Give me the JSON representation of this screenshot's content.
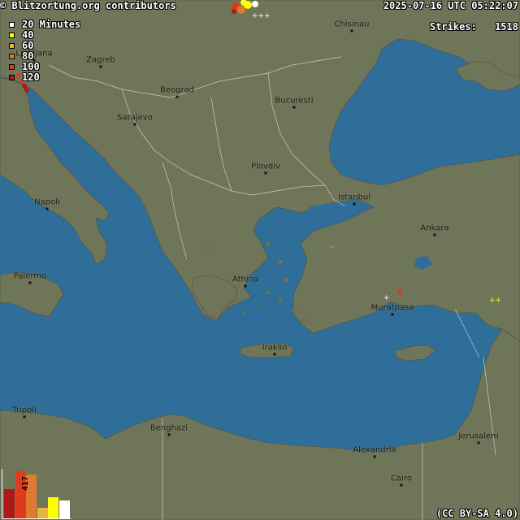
{
  "header": {
    "copyright": "© Blitzortung.org contributors",
    "timestamp": "2025-07-16 UTC 05:22:07",
    "strikes_label": "Strikes:",
    "strikes_count": "1518"
  },
  "legend": {
    "items": [
      {
        "label": "20 Minutes",
        "color": "#ffffff"
      },
      {
        "label": "40",
        "color": "#ffff00"
      },
      {
        "label": "60",
        "color": "#e8b23c"
      },
      {
        "label": "80",
        "color": "#e07a30"
      },
      {
        "label": "100",
        "color": "#e03a1e"
      },
      {
        "label": "120",
        "color": "#b01818"
      }
    ]
  },
  "histogram": {
    "max_label": "417",
    "bars": [
      {
        "value": 0.62,
        "color": "#b01818"
      },
      {
        "value": 1.0,
        "color": "#e03a1e"
      },
      {
        "value": 0.93,
        "color": "#e07a30"
      },
      {
        "value": 0.22,
        "color": "#e8b23c"
      },
      {
        "value": 0.45,
        "color": "#ffff00"
      },
      {
        "value": 0.38,
        "color": "#ffffff"
      }
    ]
  },
  "license": "(CC BY-SA 4.0)",
  "cities": [
    {
      "name": "Chisinau"
    },
    {
      "name": "Ljubljana"
    },
    {
      "name": "Zagreb"
    },
    {
      "name": "Beograd"
    },
    {
      "name": "Bucuresti"
    },
    {
      "name": "Sarajevo"
    },
    {
      "name": "Plovdiv"
    },
    {
      "name": "Istanbul"
    },
    {
      "name": "Ankara"
    },
    {
      "name": "Napoli"
    },
    {
      "name": "Palermo"
    },
    {
      "name": "Athina"
    },
    {
      "name": "Muratpasa"
    },
    {
      "name": "Iraklio"
    },
    {
      "name": "Tripoli"
    },
    {
      "name": "Benghazi"
    },
    {
      "name": "Alexandria"
    },
    {
      "name": "Cairo"
    },
    {
      "name": "Jerusalem"
    }
  ],
  "colors": {
    "sea": "#2f6e99",
    "land": "#6f7559",
    "border": "#c9c9c9"
  }
}
